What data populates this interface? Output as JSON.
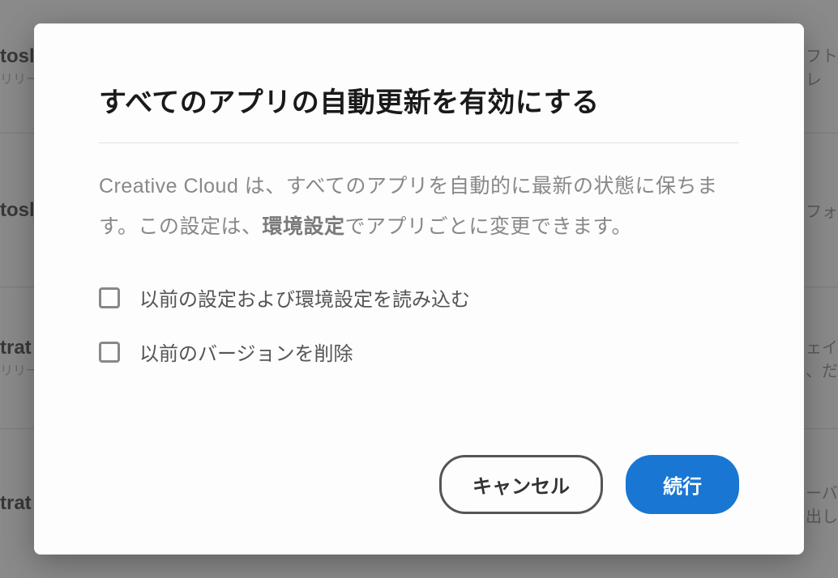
{
  "background": {
    "items": [
      {
        "title": "tosl",
        "subtitle": "リリー",
        "right_line1": "フト",
        "right_line2": "レ"
      },
      {
        "title": "tosl",
        "subtitle": "",
        "right_line1": "フォ",
        "right_line2": ""
      },
      {
        "title": "trat",
        "subtitle": "リリー",
        "right_line1": "ェイ",
        "right_line2": "、だ"
      },
      {
        "title": "trat",
        "subtitle": "",
        "right_line1": "ーバ",
        "right_line2": "出し"
      }
    ]
  },
  "dialog": {
    "title": "すべてのアプリの自動更新を有効にする",
    "description_part1": "Creative Cloud は、すべてのアプリを自動的に最新の状態に保ちます。この設定は、",
    "description_bold": "環境設定",
    "description_part2": "でアプリごとに変更できます。",
    "checkbox1_label": "以前の設定および環境設定を読み込む",
    "checkbox2_label": "以前のバージョンを削除",
    "cancel_label": "キャンセル",
    "continue_label": "続行"
  }
}
